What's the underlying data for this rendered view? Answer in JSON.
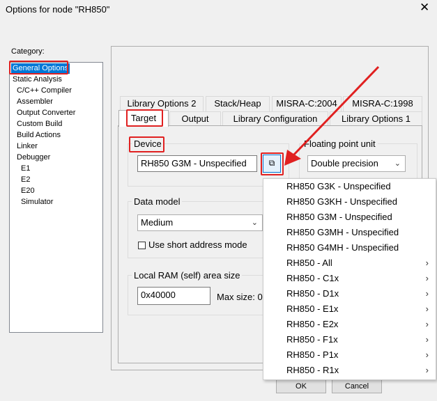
{
  "window": {
    "title": "Options for node \"RH850\"",
    "close_glyph": "✕"
  },
  "category": {
    "label": "Category:",
    "items": [
      {
        "label": "General Options"
      },
      {
        "label": "Static Analysis"
      },
      {
        "label": "C/C++ Compiler"
      },
      {
        "label": "Assembler"
      },
      {
        "label": "Output Converter"
      },
      {
        "label": "Custom Build"
      },
      {
        "label": "Build Actions"
      },
      {
        "label": "Linker"
      },
      {
        "label": "Debugger"
      },
      {
        "label": "E1"
      },
      {
        "label": "E2"
      },
      {
        "label": "E20"
      },
      {
        "label": "Simulator"
      }
    ]
  },
  "tabs": {
    "row1": [
      "Library Options 2",
      "Stack/Heap",
      "MISRA-C:2004",
      "MISRA-C:1998"
    ],
    "row2": [
      "Target",
      "Output",
      "Library Configuration",
      "Library Options 1"
    ]
  },
  "target": {
    "device_label": "Device",
    "device_value": "RH850 G3M - Unspecified",
    "fpu_label": "Floating point unit",
    "fpu_value": "Double precision",
    "data_model_label": "Data model",
    "data_model_value": "Medium",
    "short_address_label": "Use short address mode",
    "ram_label": "Local RAM (self) area size",
    "ram_value": "0x40000",
    "max_size_label": "Max size:  0"
  },
  "device_menu": [
    {
      "label": "RH850 G3K - Unspecified",
      "submenu": false
    },
    {
      "label": "RH850 G3KH - Unspecified",
      "submenu": false
    },
    {
      "label": "RH850 G3M - Unspecified",
      "submenu": false
    },
    {
      "label": "RH850 G3MH - Unspecified",
      "submenu": false
    },
    {
      "label": "RH850 G4MH - Unspecified",
      "submenu": false
    },
    {
      "label": "RH850 - All",
      "submenu": true
    },
    {
      "label": "RH850 - C1x",
      "submenu": true
    },
    {
      "label": "RH850 - D1x",
      "submenu": true
    },
    {
      "label": "RH850 - E1x",
      "submenu": true
    },
    {
      "label": "RH850 - E2x",
      "submenu": true
    },
    {
      "label": "RH850 - F1x",
      "submenu": true
    },
    {
      "label": "RH850 - P1x",
      "submenu": true
    },
    {
      "label": "RH850 - R1x",
      "submenu": true
    }
  ],
  "buttons": {
    "ok": "OK",
    "cancel": "Cancel"
  },
  "colors": {
    "highlight": "#0078d7",
    "annotation": "#e02020"
  }
}
